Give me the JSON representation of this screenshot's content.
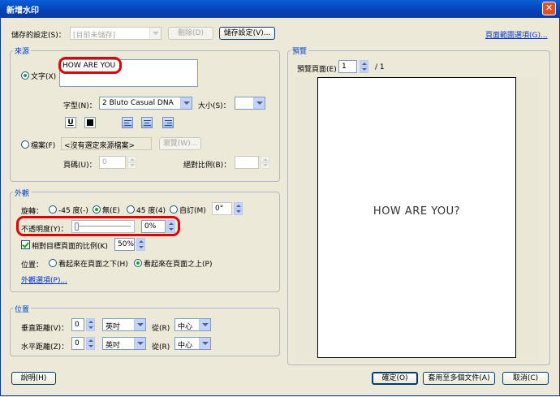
{
  "window": {
    "title": "新增水印",
    "close_glyph": "✕"
  },
  "toolbar": {
    "saved_settings_label": "儲存的設定(S)：",
    "saved_settings_value": "[目前未儲存]",
    "delete_label": "刪除(D)",
    "save_settings_label": "儲存設定(V)...",
    "page_range_link": "頁面範圍選項(G)..."
  },
  "source": {
    "legend": "來源",
    "text_radio_label": "文字(X)",
    "text_value": "HOW ARE YOU",
    "font_label": "字型(N)：",
    "font_value": "2 Bluto Casual DNA",
    "size_label": "大小(S)：",
    "size_value": "",
    "underline_glyph": "U",
    "file_radio_label": "檔案(F)",
    "file_value": "<沒有選定來源檔案>",
    "browse_label": "瀏覽(W)...",
    "page_label": "頁碼(U)：",
    "page_value": "0",
    "abs_scale_label": "絕對比例(B)：",
    "abs_scale_value": ""
  },
  "appearance": {
    "legend": "外觀",
    "rotation_label": "旋轉：",
    "rot_neg45": "-45 度(-)",
    "rot_none": "無(E)",
    "rot_45": "45 度(4)",
    "rot_custom": "自訂(M)",
    "rot_custom_value": "0°",
    "opacity_label": "不透明度(Y)：",
    "opacity_value": "0%",
    "opacity_level": 0.0,
    "relative_scale_label": "相對目標頁面的比例(K)",
    "relative_scale_value": "50%",
    "position_label": "位置：",
    "pos_behind": "看起來在頁面之下(H)",
    "pos_front": "看起來在頁面之上(P)",
    "options_link": "外觀選項(P)..."
  },
  "position": {
    "legend": "位置",
    "vertical_label": "垂直距離(V)：",
    "vertical_value": "0",
    "vertical_unit": "英吋",
    "vertical_from_label": "從(R)",
    "vertical_from_value": "中心",
    "horizontal_label": "水平距離(Z)：",
    "horizontal_value": "0",
    "horizontal_unit": "英吋",
    "horizontal_from_label": "從(R)",
    "horizontal_from_value": "中心"
  },
  "preview": {
    "legend": "預覽",
    "page_label": "預覽頁面(E)",
    "page_value": "1",
    "page_total": "/ 1",
    "watermark_text": "HOW ARE YOU?"
  },
  "footer": {
    "help_label": "說明(H)",
    "ok_label": "確定(O)",
    "apply_multi_label": "套用至多個文件(A)",
    "cancel_label": "取消(C)"
  },
  "colors": {
    "title_bar": "#0541b6",
    "legend_text": "#0040c0",
    "highlight_mark": "#e00000",
    "link": "#0033cc"
  }
}
